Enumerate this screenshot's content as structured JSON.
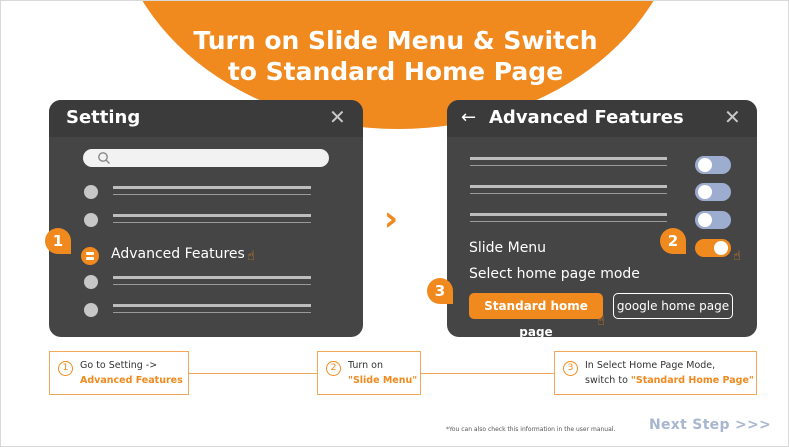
{
  "title_line1": "Turn on Slide Menu & Switch",
  "title_line2": "to Standard Home Page",
  "left_panel": {
    "title": "Setting",
    "close": "✕",
    "search_placeholder": "",
    "highlight_item": "Advanced Features"
  },
  "right_panel": {
    "back": "←",
    "title": "Advanced Features",
    "close": "✕",
    "slide_menu_label": "Slide Menu",
    "slide_menu_on": true,
    "home_mode_label": "Select home page mode",
    "btn_standard": "Standard home page",
    "btn_google": "google home page"
  },
  "arrow": "»",
  "badges": [
    "1",
    "2",
    "3"
  ],
  "steps": [
    {
      "num": "1",
      "line1": "Go to Setting ->",
      "line2": "Advanced Features"
    },
    {
      "num": "2",
      "line1": "Turn on",
      "line2": "\"Slide Menu\""
    },
    {
      "num": "3",
      "line1": "In Select Home Page Mode,",
      "line2_prefix": "switch to ",
      "line2": "\"Standard Home Page\""
    }
  ],
  "note": "*You can also check this information in the user manual.",
  "next_step": "Next Step >>>",
  "colors": {
    "accent": "#f08a1f",
    "panel": "#454545",
    "toggle_off": "#9dadd0",
    "next": "#a9b6cf"
  },
  "icons": [
    "search-icon",
    "close-icon",
    "back-arrow-icon",
    "toggle-icon",
    "hand-pointer-icon",
    "double-chevron-icon"
  ]
}
